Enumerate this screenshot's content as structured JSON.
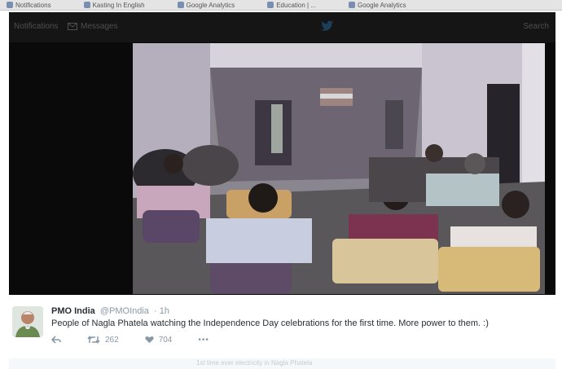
{
  "browser": {
    "bookmarks": [
      {
        "label": "Notifications",
        "icon": "bookmark-favicon"
      },
      {
        "label": "Kasting In English",
        "icon": "bookmark-favicon"
      },
      {
        "label": "Google Analytics",
        "icon": "bookmark-favicon"
      },
      {
        "label": "Education | ...",
        "icon": "bookmark-favicon"
      },
      {
        "label": "Google Analytics",
        "icon": "bookmark-favicon"
      }
    ]
  },
  "nav": {
    "home_label": "Notifications",
    "messages_label": "Messages",
    "bird_icon": "twitter-bird-icon",
    "right_label": "Search"
  },
  "photo": {
    "alt_icon": "tweet-photo"
  },
  "tweet": {
    "name": "PMO India",
    "handle": "@PMOIndia",
    "time": "· 1h",
    "text": "People of Nagla Phatela watching the Independence Day celebrations for the first time. More power to them. :)",
    "actions": {
      "reply_icon": "reply-icon",
      "retweet_icon": "retweet-icon",
      "retweet_count": "262",
      "like_icon": "heart-icon",
      "like_count": "704",
      "more_icon": "more-icon",
      "more_label": "•••"
    }
  },
  "footer": {
    "faded_text": "1st time ever electricity in Nagla Phatela"
  },
  "colors": {
    "nav_bg": "#151515",
    "backdrop": "#0a0a0a",
    "text": "#292f33",
    "muted": "#8899a6"
  }
}
